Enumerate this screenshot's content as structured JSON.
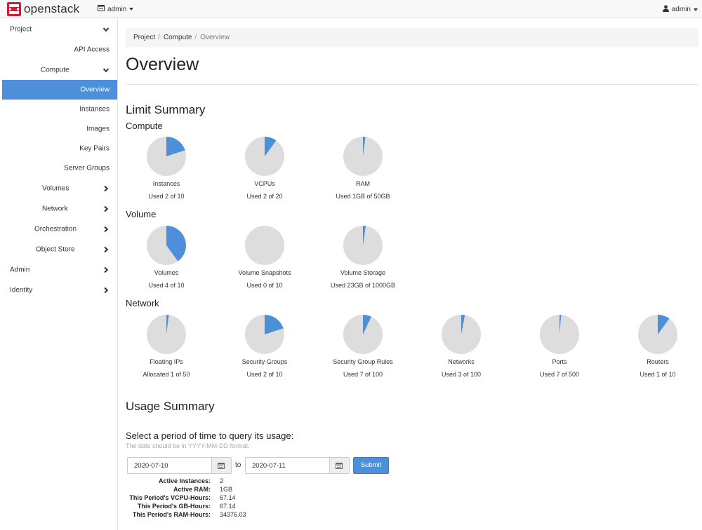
{
  "colors": {
    "accent": "#4e8fd9",
    "pie_bg": "#dddddd",
    "logo_red": "#da1a32"
  },
  "navbar": {
    "brand": "openstack",
    "project_selector": "admin",
    "user_menu": "admin"
  },
  "sidebar": {
    "items": [
      {
        "label": "Project"
      },
      {
        "label": "API Access"
      },
      {
        "label": "Compute"
      },
      {
        "label": "Overview"
      },
      {
        "label": "Instances"
      },
      {
        "label": "Images"
      },
      {
        "label": "Key Pairs"
      },
      {
        "label": "Server Groups"
      },
      {
        "label": "Volumes"
      },
      {
        "label": "Network"
      },
      {
        "label": "Orchestration"
      },
      {
        "label": "Object Store"
      },
      {
        "label": "Admin"
      },
      {
        "label": "Identity"
      }
    ]
  },
  "breadcrumb": {
    "items": [
      "Project",
      "Compute"
    ],
    "current": "Overview"
  },
  "page": {
    "title": "Overview"
  },
  "limit_summary": {
    "title": "Limit Summary",
    "groups": [
      {
        "title": "Compute",
        "charts": [
          {
            "label": "Instances",
            "used_text": "Used 2 of 10",
            "fraction": 0.2
          },
          {
            "label": "VCPUs",
            "used_text": "Used 2 of 20",
            "fraction": 0.1
          },
          {
            "label": "RAM",
            "used_text": "Used 1GB of 50GB",
            "fraction": 0.02
          }
        ]
      },
      {
        "title": "Volume",
        "charts": [
          {
            "label": "Volumes",
            "used_text": "Used 4 of 10",
            "fraction": 0.4
          },
          {
            "label": "Volume Snapshots",
            "used_text": "Used 0 of 10",
            "fraction": 0
          },
          {
            "label": "Volume Storage",
            "used_text": "Used 23GB of 1000GB",
            "fraction": 0.023
          }
        ]
      },
      {
        "title": "Network",
        "charts": [
          {
            "label": "Floating IPs",
            "used_text": "Allocated 1 of 50",
            "fraction": 0.02
          },
          {
            "label": "Security Groups",
            "used_text": "Used 2 of 10",
            "fraction": 0.2
          },
          {
            "label": "Security Group Rules",
            "used_text": "Used 7 of 100",
            "fraction": 0.07
          },
          {
            "label": "Networks",
            "used_text": "Used 3 of 100",
            "fraction": 0.03
          },
          {
            "label": "Ports",
            "used_text": "Used 7 of 500",
            "fraction": 0.014
          },
          {
            "label": "Routers",
            "used_text": "Used 1 of 10",
            "fraction": 0.1
          }
        ]
      }
    ]
  },
  "usage_summary": {
    "title": "Usage Summary",
    "query_title": "Select a period of time to query its usage:",
    "hint": "The date should be in YYYY-MM-DD format.",
    "start_date": "2020-07-10",
    "to_label": "to",
    "end_date": "2020-07-11",
    "submit_label": "Submit",
    "stats": [
      {
        "label": "Active Instances:",
        "value": "2"
      },
      {
        "label": "Active RAM:",
        "value": "1GB"
      },
      {
        "label": "This Period's VCPU-Hours:",
        "value": "67.14"
      },
      {
        "label": "This Period's GB-Hours:",
        "value": "67.14"
      },
      {
        "label": "This Period's RAM-Hours:",
        "value": "34376.03"
      }
    ]
  }
}
